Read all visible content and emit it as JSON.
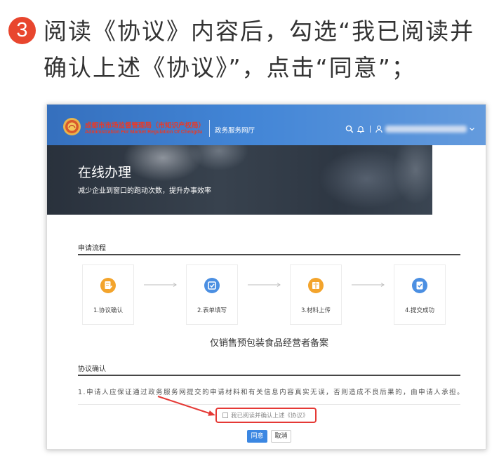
{
  "instruction": {
    "step_number": "3",
    "line1": "阅读《协议》内容后，勾选“我已阅读并",
    "line2": "确认上述《协议》”，点击“同意”；"
  },
  "colors": {
    "step_badge": "#e8462e",
    "header_blue": "#4285d6",
    "org_text": "#e63b2a",
    "primary_button": "#3b87e2",
    "annotation_red": "#e53935"
  },
  "portal": {
    "header": {
      "logo_icon": "city-emblem-icon",
      "org_name_cn": "成都市市场监督管理局（市知识产权局）",
      "org_name_en": "Administration For Market Regulation Of Chengdu",
      "portal_name": "政务服务网厅",
      "icons": [
        "search-icon",
        "bell-icon",
        "user-icon",
        "chevron-down-icon"
      ]
    },
    "banner": {
      "title": "在线办理",
      "subtitle": "减少企业到窗口的跑动次数，提升办事效率"
    },
    "process": {
      "heading": "申请流程",
      "steps": [
        {
          "label": "1.协议确认",
          "icon": "agreement-pen-icon",
          "color": "#f3a42c"
        },
        {
          "label": "2.表单填写",
          "icon": "form-edit-icon",
          "color": "#4b8fe2"
        },
        {
          "label": "3.材料上传",
          "icon": "book-upload-icon",
          "color": "#f3a42c"
        },
        {
          "label": "4.提交成功",
          "icon": "document-check-icon",
          "color": "#4b8fe2"
        }
      ]
    },
    "service_title": "仅销售预包装食品经营者备案",
    "agreement": {
      "heading": "协议确认",
      "clause": "1.申请人应保证通过政务服务网提交的申请材料和有关信息内容真实无误，否则造成不良后果的，由申请人承担。",
      "checkbox_label": "我已阅读并确认上述《协议》",
      "checked": false
    },
    "actions": {
      "agree_label": "同意",
      "cancel_label": "取消"
    }
  }
}
